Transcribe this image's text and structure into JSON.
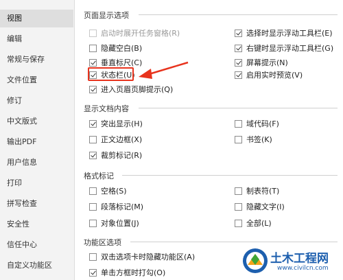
{
  "sidebar": {
    "items": [
      {
        "label": "视图",
        "active": true
      },
      {
        "label": "编辑"
      },
      {
        "label": "常规与保存"
      },
      {
        "label": "文件位置"
      },
      {
        "label": "修订"
      },
      {
        "label": "中文版式"
      },
      {
        "label": "输出PDF"
      },
      {
        "label": "用户信息"
      },
      {
        "label": "打印"
      },
      {
        "label": "拼写检查"
      },
      {
        "label": "安全性"
      },
      {
        "label": "信任中心"
      },
      {
        "label": "自定义功能区"
      }
    ]
  },
  "sections": {
    "page_display": {
      "title": "页面显示选项",
      "left": [
        {
          "label": "启动时展开任务窗格(R)",
          "checked": false,
          "disabled": true
        },
        {
          "label": "隐藏空白(B)",
          "checked": false
        },
        {
          "label": "垂直标尺(C)",
          "checked": true
        },
        {
          "label": "状态栏(U)",
          "checked": true
        },
        {
          "label": "进入页眉页脚提示(Q)",
          "checked": true
        }
      ],
      "right": [
        {
          "label": "选择时显示浮动工具栏(E)",
          "checked": true
        },
        {
          "label": "右键时显示浮动工具栏(G)",
          "checked": true
        },
        {
          "label": "屏幕提示(N)",
          "checked": true
        },
        {
          "label": "启用实时预览(V)",
          "checked": true
        }
      ]
    },
    "doc_content": {
      "title": "显示文档内容",
      "left": [
        {
          "label": "突出显示(H)",
          "checked": true
        },
        {
          "label": "正文边框(X)",
          "checked": false
        },
        {
          "label": "裁剪标记(R)",
          "checked": true
        }
      ],
      "right": [
        {
          "label": "域代码(F)",
          "checked": false
        },
        {
          "label": "书签(K)",
          "checked": false
        }
      ]
    },
    "format_marks": {
      "title": "格式标记",
      "left": [
        {
          "label": "空格(S)",
          "checked": false
        },
        {
          "label": "段落标记(M)",
          "checked": false
        },
        {
          "label": "对象位置(J)",
          "checked": false
        }
      ],
      "right": [
        {
          "label": "制表符(T)",
          "checked": false
        },
        {
          "label": "隐藏文字(I)",
          "checked": false
        },
        {
          "label": "全部(L)",
          "checked": false
        }
      ]
    },
    "ribbon": {
      "title": "功能区选项",
      "left": [
        {
          "label": "双击选项卡时隐藏功能区(A)",
          "checked": false
        },
        {
          "label": "单击方框时打勾(O)",
          "checked": true
        }
      ]
    }
  },
  "annotation": {
    "color": "#e8331d"
  },
  "watermark": {
    "title": "土木工程网",
    "url": "www.civilcn.com"
  }
}
